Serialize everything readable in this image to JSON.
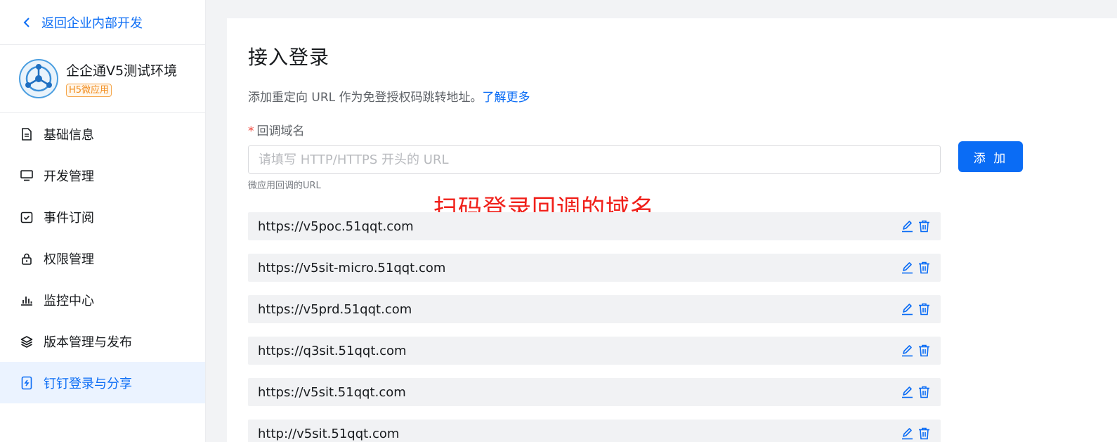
{
  "sidebar": {
    "back_label": "返回企业内部开发",
    "app": {
      "name": "企企通V5测试环境",
      "badge": "H5微应用"
    },
    "items": [
      {
        "label": "基础信息",
        "icon": "document-icon"
      },
      {
        "label": "开发管理",
        "icon": "monitor-icon"
      },
      {
        "label": "事件订阅",
        "icon": "calendar-check-icon"
      },
      {
        "label": "权限管理",
        "icon": "lock-icon"
      },
      {
        "label": "监控中心",
        "icon": "bar-chart-icon"
      },
      {
        "label": "版本管理与发布",
        "icon": "layers-icon"
      },
      {
        "label": "钉钉登录与分享",
        "icon": "phone-share-icon",
        "active": true
      }
    ]
  },
  "main": {
    "title": "接入登录",
    "description": "添加重定向 URL 作为免登授权码跳转地址。",
    "learn_more": "了解更多",
    "field": {
      "required_mark": "*",
      "label": "回调域名",
      "placeholder": "请填写 HTTP/HTTPS 开头的 URL",
      "value": "",
      "hint": "微应用回调的URL"
    },
    "add_label": "添 加",
    "annotation": "扫码登录回调的域名",
    "urls": [
      "https://v5poc.51qqt.com",
      "https://v5sit-micro.51qqt.com",
      "https://v5prd.51qqt.com",
      "https://q3sit.51qqt.com",
      "https://v5sit.51qqt.com",
      "http://v5sit.51qqt.com"
    ]
  },
  "colors": {
    "accent": "#0a6cf5",
    "annotation": "#f0201a",
    "badge": "#f28d1e"
  }
}
